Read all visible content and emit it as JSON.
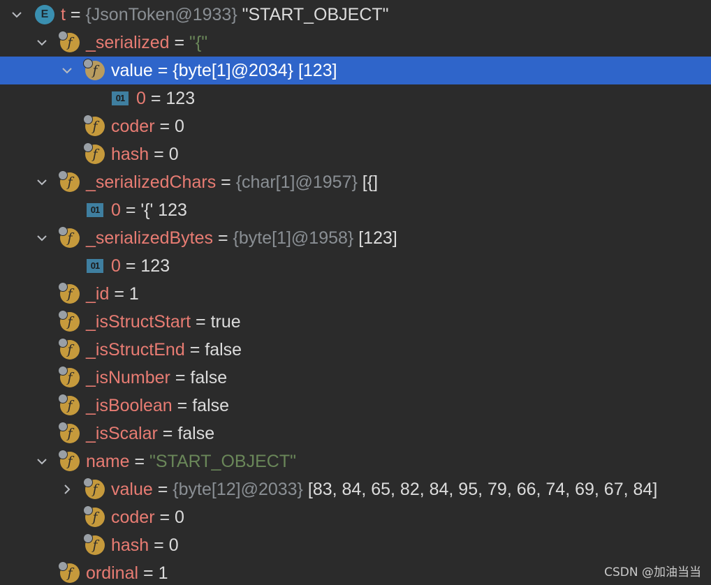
{
  "rows": [
    {
      "depth": 0,
      "arrow": "expanded",
      "icon": "enum-icon",
      "name": "t",
      "eq": " = ",
      "ref": "{JsonToken@1933}",
      "value": " \"START_OBJECT\"",
      "value_style": "val",
      "selected": false
    },
    {
      "depth": 1,
      "arrow": "expanded",
      "icon": "field-icon",
      "name": "_serialized",
      "eq": " = ",
      "ref": "",
      "value": "\"{\"",
      "value_style": "str",
      "selected": false
    },
    {
      "depth": 2,
      "arrow": "expanded",
      "icon": "field-icon",
      "name": "value",
      "eq": " = ",
      "ref": "{byte[1]@2034}",
      "value": " [123]",
      "value_style": "val",
      "selected": true
    },
    {
      "depth": 3,
      "arrow": "none",
      "icon": "primitive-icon",
      "name": "0",
      "eq": " = ",
      "ref": "",
      "value": "123",
      "value_style": "val",
      "selected": false
    },
    {
      "depth": 2,
      "arrow": "none",
      "icon": "field-icon",
      "name": "coder",
      "eq": " = ",
      "ref": "",
      "value": "0",
      "value_style": "val",
      "selected": false
    },
    {
      "depth": 2,
      "arrow": "none",
      "icon": "field-icon",
      "name": "hash",
      "eq": " = ",
      "ref": "",
      "value": "0",
      "value_style": "val",
      "selected": false
    },
    {
      "depth": 1,
      "arrow": "expanded",
      "icon": "field-icon",
      "name": "_serializedChars",
      "eq": " = ",
      "ref": "{char[1]@1957}",
      "value": " [{]",
      "value_style": "val",
      "selected": false
    },
    {
      "depth": 2,
      "arrow": "none",
      "icon": "primitive-icon",
      "name": "0",
      "eq": " = ",
      "ref": "",
      "value": "'{' 123",
      "value_style": "val",
      "selected": false
    },
    {
      "depth": 1,
      "arrow": "expanded",
      "icon": "field-icon",
      "name": "_serializedBytes",
      "eq": " = ",
      "ref": "{byte[1]@1958}",
      "value": " [123]",
      "value_style": "val",
      "selected": false
    },
    {
      "depth": 2,
      "arrow": "none",
      "icon": "primitive-icon",
      "name": "0",
      "eq": " = ",
      "ref": "",
      "value": "123",
      "value_style": "val",
      "selected": false
    },
    {
      "depth": 1,
      "arrow": "none",
      "icon": "field-icon",
      "name": "_id",
      "eq": " = ",
      "ref": "",
      "value": "1",
      "value_style": "val",
      "selected": false
    },
    {
      "depth": 1,
      "arrow": "none",
      "icon": "field-icon",
      "name": "_isStructStart",
      "eq": " = ",
      "ref": "",
      "value": "true",
      "value_style": "val",
      "selected": false
    },
    {
      "depth": 1,
      "arrow": "none",
      "icon": "field-icon",
      "name": "_isStructEnd",
      "eq": " = ",
      "ref": "",
      "value": "false",
      "value_style": "val",
      "selected": false
    },
    {
      "depth": 1,
      "arrow": "none",
      "icon": "field-icon",
      "name": "_isNumber",
      "eq": " = ",
      "ref": "",
      "value": "false",
      "value_style": "val",
      "selected": false
    },
    {
      "depth": 1,
      "arrow": "none",
      "icon": "field-icon",
      "name": "_isBoolean",
      "eq": " = ",
      "ref": "",
      "value": "false",
      "value_style": "val",
      "selected": false
    },
    {
      "depth": 1,
      "arrow": "none",
      "icon": "field-icon",
      "name": "_isScalar",
      "eq": " = ",
      "ref": "",
      "value": "false",
      "value_style": "val",
      "selected": false
    },
    {
      "depth": 1,
      "arrow": "expanded",
      "icon": "field-icon",
      "name": "name",
      "eq": " = ",
      "ref": "",
      "value": "\"START_OBJECT\"",
      "value_style": "str",
      "selected": false
    },
    {
      "depth": 2,
      "arrow": "collapsed",
      "icon": "field-icon",
      "name": "value",
      "eq": " = ",
      "ref": "{byte[12]@2033}",
      "value": " [83, 84, 65, 82, 84, 95, 79, 66, 74, 69, 67, 84]",
      "value_style": "val",
      "selected": false
    },
    {
      "depth": 2,
      "arrow": "none",
      "icon": "field-icon",
      "name": "coder",
      "eq": " = ",
      "ref": "",
      "value": "0",
      "value_style": "val",
      "selected": false
    },
    {
      "depth": 2,
      "arrow": "none",
      "icon": "field-icon",
      "name": "hash",
      "eq": " = ",
      "ref": "",
      "value": "0",
      "value_style": "val",
      "selected": false
    },
    {
      "depth": 1,
      "arrow": "none",
      "icon": "field-icon",
      "name": "ordinal",
      "eq": " = ",
      "ref": "",
      "value": "1",
      "value_style": "val",
      "selected": false
    }
  ],
  "icons": {
    "enum_glyph": "E",
    "field_glyph": "f",
    "primitive_glyph": "01"
  },
  "colors": {
    "background": "#2b2b2b",
    "selection": "#2f65ca",
    "field_name": "#e87c73",
    "string_value": "#6a8759",
    "reference": "#8a8f94",
    "field_icon": "#c69a3c",
    "enum_icon": "#3a8fb0",
    "primitive_icon": "#3f7fa0"
  },
  "watermark": "CSDN @加油当当"
}
